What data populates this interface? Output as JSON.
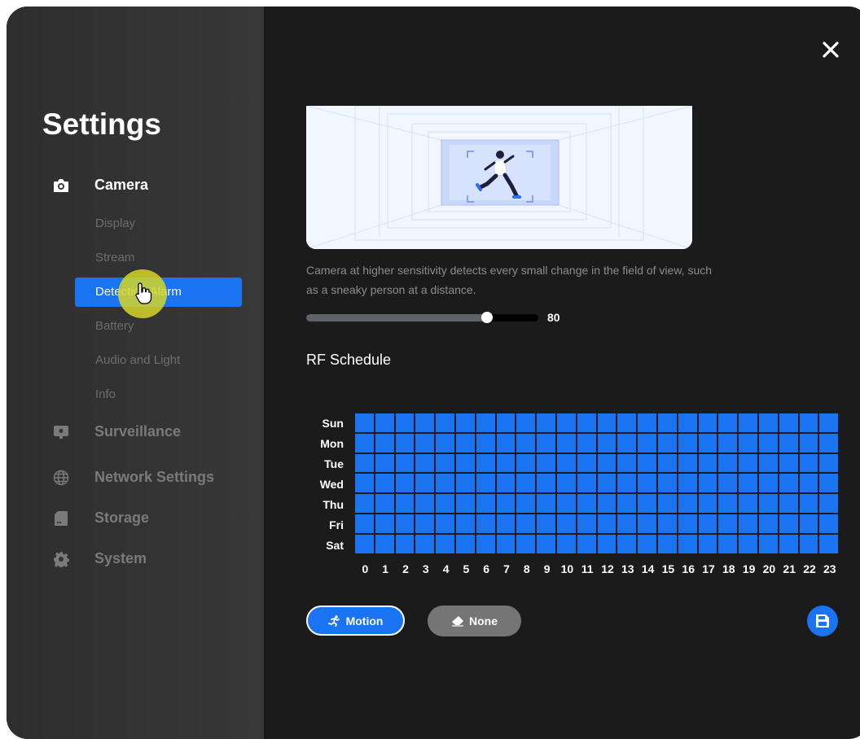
{
  "sidebar": {
    "title": "Settings",
    "sections": [
      {
        "label": "Camera",
        "icon": "camera-icon",
        "active": true
      },
      {
        "label": "Surveillance",
        "icon": "monitor-icon"
      },
      {
        "label": "Network Settings",
        "icon": "globe-icon"
      },
      {
        "label": "Storage",
        "icon": "sd-card-icon"
      },
      {
        "label": "System",
        "icon": "gear-icon"
      }
    ],
    "camera_items": [
      {
        "label": "Display"
      },
      {
        "label": "Stream"
      },
      {
        "label": "Detection Alarm",
        "active": true
      },
      {
        "label": "Battery"
      },
      {
        "label": "Audio and Light"
      },
      {
        "label": "Info"
      }
    ]
  },
  "main": {
    "close_icon": "close-icon",
    "description": "Camera at higher sensitivity detects every small change in the field of view, such as a sneaky person at a distance.",
    "sensitivity": {
      "value": "80",
      "fraction": 0.78
    },
    "schedule": {
      "title": "RF Schedule",
      "days": [
        "Sun",
        "Mon",
        "Tue",
        "Wed",
        "Thu",
        "Fri",
        "Sat"
      ],
      "hours": [
        "0",
        "1",
        "2",
        "3",
        "4",
        "5",
        "6",
        "7",
        "8",
        "9",
        "10",
        "11",
        "12",
        "13",
        "14",
        "15",
        "16",
        "17",
        "18",
        "19",
        "20",
        "21",
        "22",
        "23"
      ],
      "all_cells_state": "motion"
    },
    "buttons": {
      "motion_label": "Motion",
      "none_label": "None"
    }
  },
  "colors": {
    "accent": "#1a73f0",
    "background": "#1b1b1b",
    "sidebar": "#333333",
    "none_button": "#757575"
  }
}
